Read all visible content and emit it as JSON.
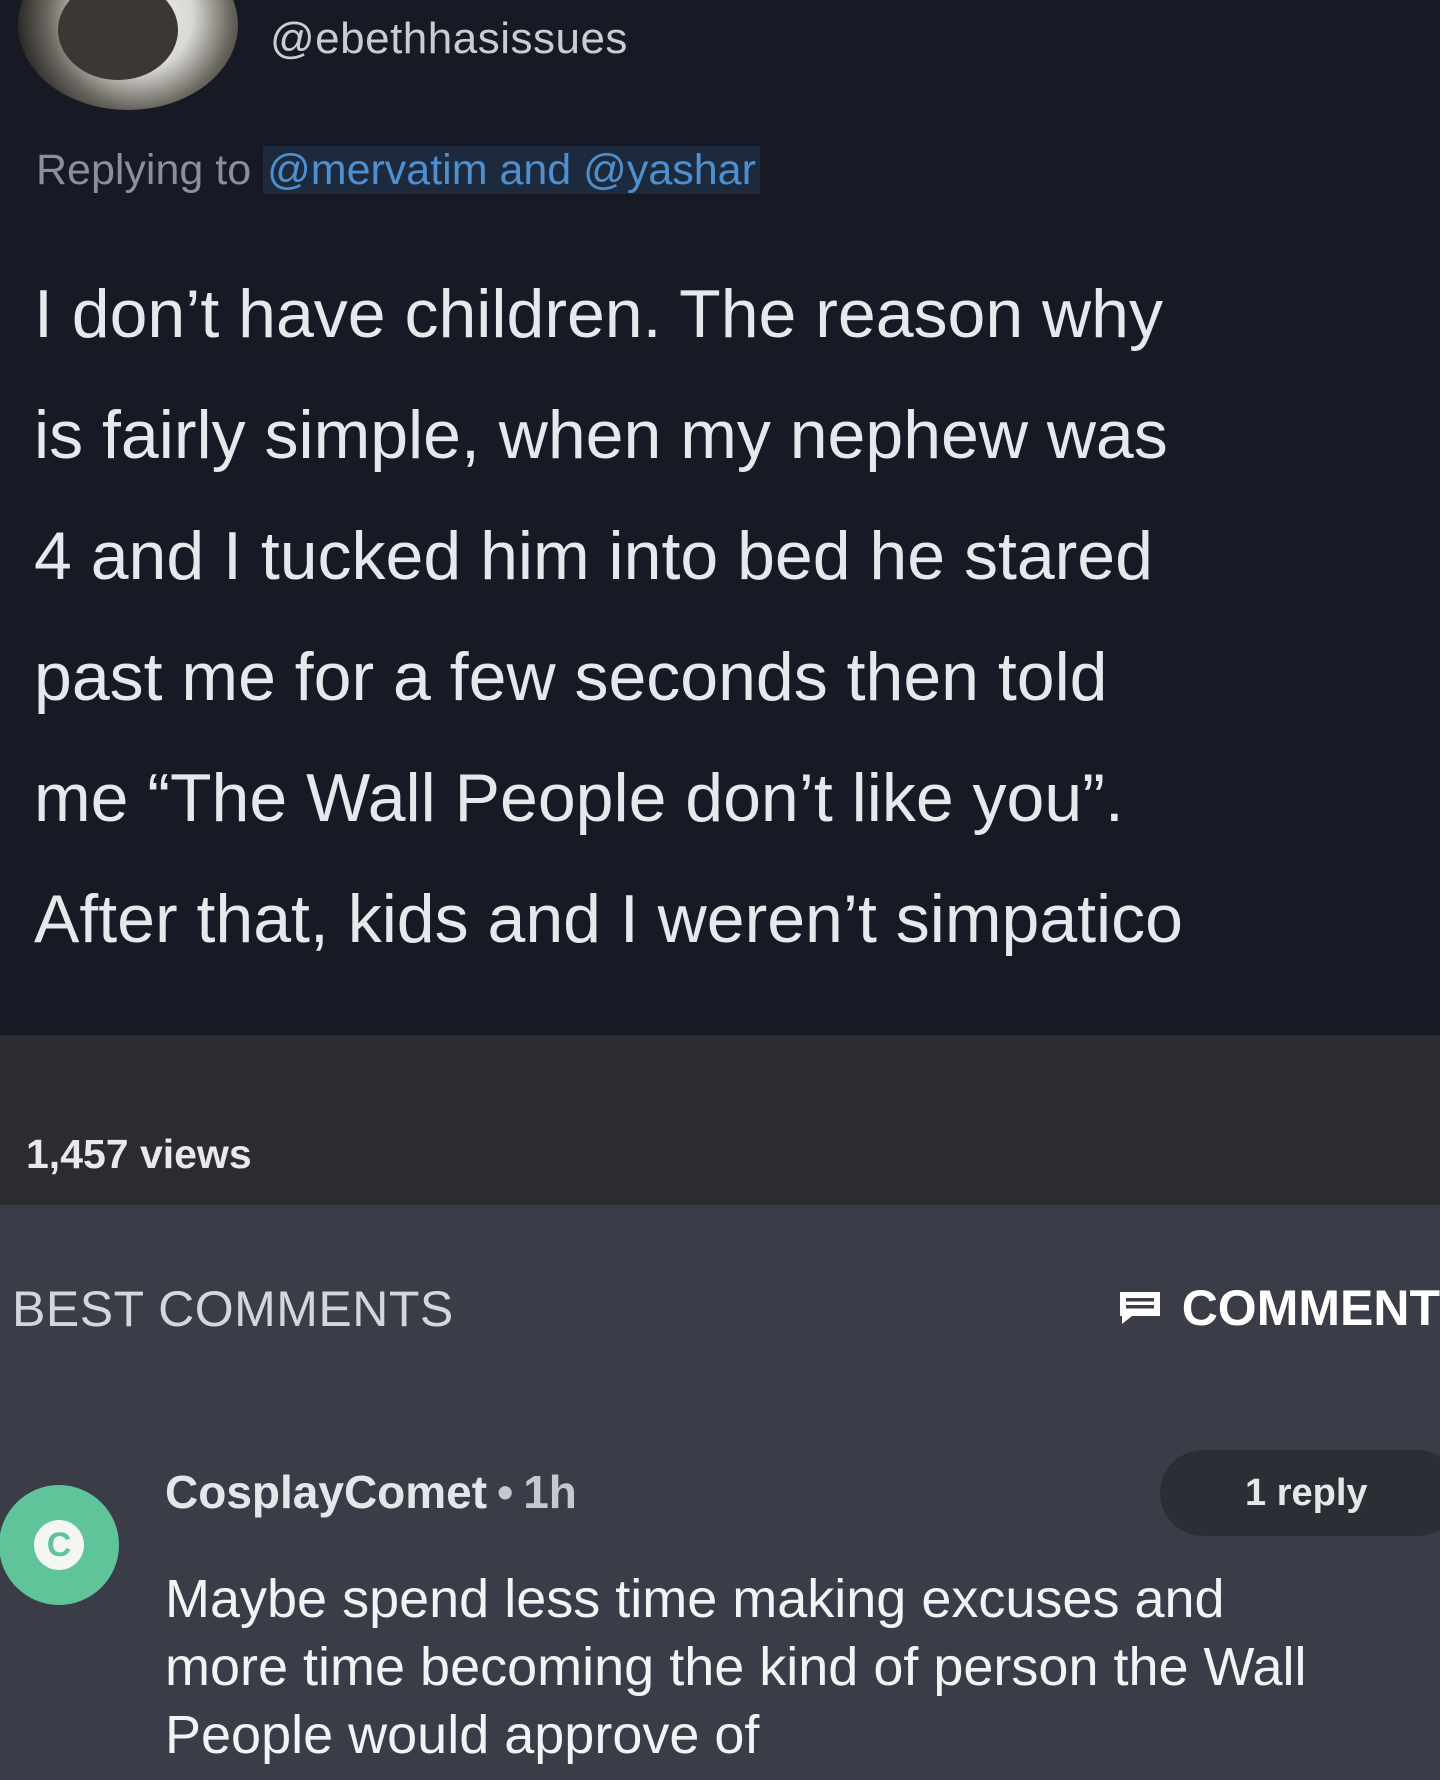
{
  "tweet": {
    "handle": "@ebethhasissues",
    "replying_prefix": "Replying to",
    "replying_mentions": "@mervatim and @yashar",
    "body_lines": [
      "I don’t have children. The reason why",
      "is fairly simple, when my nephew was",
      "4 and I tucked him into bed he stared",
      "past me for a few seconds then told",
      "me “The Wall People don’t like you”.",
      "After that, kids and I weren’t simpatico"
    ]
  },
  "post": {
    "views": "1,457 views"
  },
  "comments": {
    "section_title": "BEST COMMENTS",
    "comment_button_label": "COMMENT",
    "comment_icon": "comment-icon",
    "items": [
      {
        "avatar_letter": "C",
        "avatar_color": "#5fc49a",
        "username": "CosplayComet",
        "separator": "•",
        "time": "1h",
        "replies": "1 reply",
        "text_lines": [
          "Maybe spend less time making excuses and",
          "more time becoming the kind of person the Wall",
          "People would approve of"
        ]
      }
    ]
  }
}
